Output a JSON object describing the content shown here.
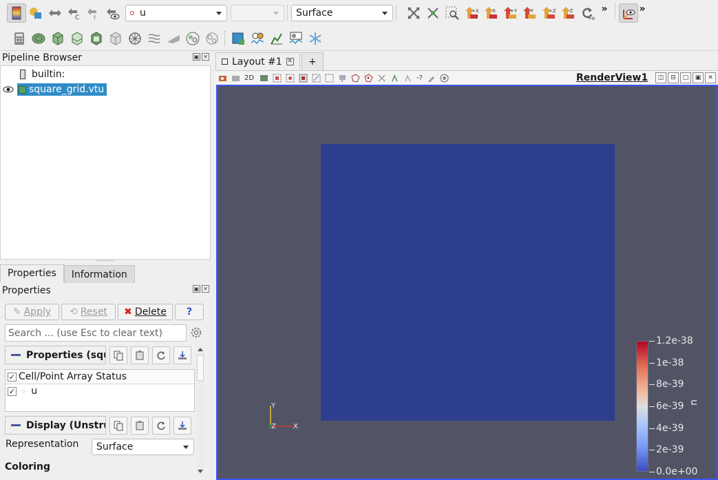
{
  "toolbar": {
    "color_array": "u",
    "component": "",
    "representation": "Surface"
  },
  "pipeline_browser": {
    "title": "Pipeline Browser",
    "items": [
      {
        "label": "builtin:"
      },
      {
        "label": "square_grid.vtu",
        "selected": true,
        "visible": true
      }
    ]
  },
  "left_tabs": [
    "Properties",
    "Information"
  ],
  "properties_panel": {
    "title": "Properties",
    "apply_label": "Apply",
    "reset_label": "Reset",
    "delete_label": "Delete",
    "help_label": "?",
    "search_placeholder": "Search ... (use Esc to clear text)",
    "properties_section": "Properties (squa",
    "array_status_header": "Cell/Point Array Status",
    "arrays": [
      {
        "name": "u",
        "checked": true
      }
    ],
    "display_section": "Display (Unstru",
    "representation_label": "Representation",
    "representation_value": "Surface",
    "coloring_label": "Coloring"
  },
  "layout": {
    "tab_label": "Layout #1",
    "add_tab": "+",
    "view_2d_label": "2D",
    "render_view_label": "RenderView1"
  },
  "render": {
    "background_color": "#525466",
    "mesh_color": "#2e3e8f",
    "selection_border_color": "#3b55ff",
    "orientation_axes": {
      "y": "Y",
      "z": "Z",
      "x": "X"
    }
  },
  "color_legend": {
    "title": "u",
    "labels": [
      "1.2e-38",
      "1e-38",
      "8e-39",
      "6e-39",
      "4e-39",
      "2e-39",
      "0.0e+00"
    ],
    "colormap": "Cool to Warm"
  }
}
